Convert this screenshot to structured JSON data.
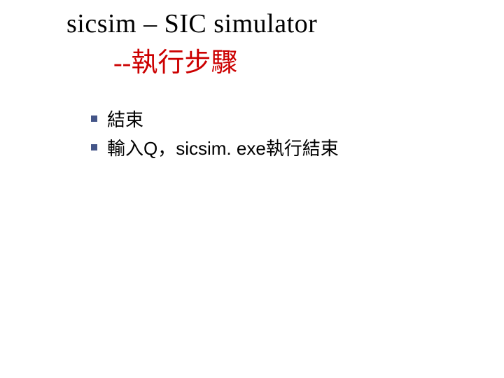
{
  "title": {
    "line1": "sicsim – SIC simulator",
    "dashes": "--",
    "line2": "執行步驟"
  },
  "bullets": [
    {
      "text": "結束"
    },
    {
      "text": "輸入Q，sicsim. exe執行結束"
    }
  ]
}
